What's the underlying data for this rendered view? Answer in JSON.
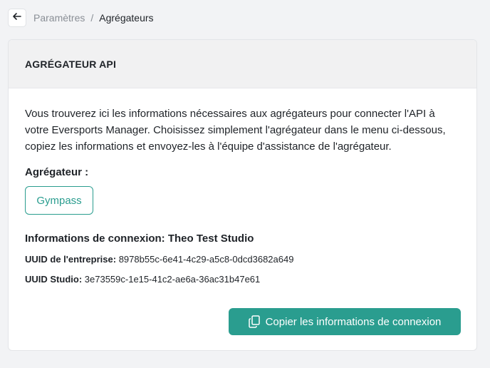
{
  "breadcrumb": {
    "parent": "Paramètres",
    "separator": "/",
    "current": "Agrégateurs"
  },
  "card": {
    "title": "AGRÉGATEUR API",
    "intro": "Vous trouverez ici les informations nécessaires aux agrégateurs pour connecter l'API à votre Eversports Manager. Choisissez simplement l'agrégateur dans le menu ci-dessous, copiez les informations et envoyez-les à l'équipe d'assistance de l'agrégateur.",
    "aggregator_label": "Agrégateur :",
    "aggregator_option": "Gympass",
    "connection_title": "Informations de connexion: Theo Test Studio",
    "company_uuid_label": "UUID de l'entreprise:",
    "company_uuid_value": "8978b55c-6e41-4c29-a5c8-0dcd3682a649",
    "studio_uuid_label": "UUID Studio:",
    "studio_uuid_value": "3e73559c-1e15-41c2-ae6a-36ac31b47e61",
    "copy_button": "Copier les informations de connexion"
  },
  "colors": {
    "accent": "#2a9d8f",
    "background": "#f2f3f5",
    "header_bg": "#f1f1f2"
  },
  "icons": {
    "back": "arrow-left-icon",
    "copy": "copy-icon"
  }
}
